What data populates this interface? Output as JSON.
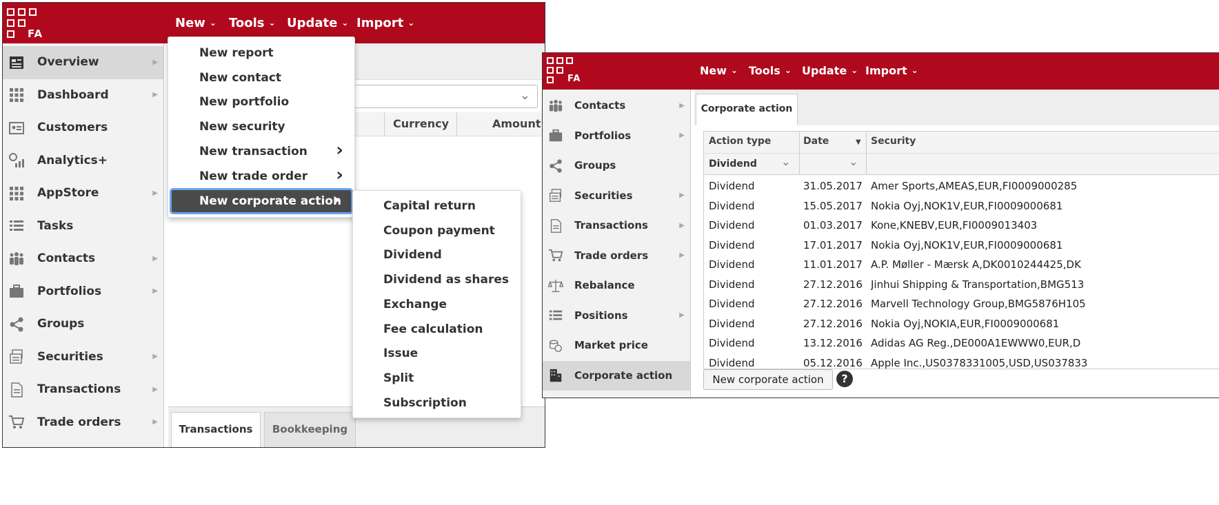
{
  "left": {
    "logo_text": "FA",
    "nav": [
      {
        "label": "New"
      },
      {
        "label": "Tools"
      },
      {
        "label": "Update"
      },
      {
        "label": "Import"
      }
    ],
    "sidebar": [
      {
        "label": "Overview",
        "icon": "overview-icon",
        "arrow": true,
        "active": true
      },
      {
        "label": "Dashboard",
        "icon": "dashboard-icon",
        "arrow": true
      },
      {
        "label": "Customers",
        "icon": "customers-icon",
        "arrow": false
      },
      {
        "label": "Analytics+",
        "icon": "analytics-icon",
        "arrow": false
      },
      {
        "label": "AppStore",
        "icon": "appstore-icon",
        "arrow": true
      },
      {
        "label": "Tasks",
        "icon": "tasks-icon",
        "arrow": false
      },
      {
        "label": "Contacts",
        "icon": "contacts-icon",
        "arrow": true
      },
      {
        "label": "Portfolios",
        "icon": "portfolios-icon",
        "arrow": true
      },
      {
        "label": "Groups",
        "icon": "groups-icon",
        "arrow": false
      },
      {
        "label": "Securities",
        "icon": "securities-icon",
        "arrow": true
      },
      {
        "label": "Transactions",
        "icon": "transactions-icon",
        "arrow": true
      },
      {
        "label": "Trade orders",
        "icon": "trade-orders-icon",
        "arrow": true
      }
    ],
    "table_headers": [
      "Currency",
      "Amount"
    ],
    "bottom_tabs": [
      "Transactions",
      "Bookkeeping"
    ],
    "new_menu": [
      {
        "label": "New report",
        "sub": false
      },
      {
        "label": "New contact",
        "sub": false
      },
      {
        "label": "New portfolio",
        "sub": false
      },
      {
        "label": "New security",
        "sub": false
      },
      {
        "label": "New transaction",
        "sub": true
      },
      {
        "label": "New trade order",
        "sub": true
      },
      {
        "label": "New corporate action",
        "sub": true,
        "highlighted": true
      }
    ],
    "submenu": [
      "Capital return",
      "Coupon payment",
      "Dividend",
      "Dividend as shares",
      "Exchange",
      "Fee calculation",
      "Issue",
      "Split",
      "Subscription"
    ]
  },
  "right": {
    "logo_text": "FA",
    "nav": [
      {
        "label": "New"
      },
      {
        "label": "Tools"
      },
      {
        "label": "Update"
      },
      {
        "label": "Import"
      }
    ],
    "sidebar": [
      {
        "label": "Contacts",
        "icon": "contacts-icon",
        "arrow": true
      },
      {
        "label": "Portfolios",
        "icon": "portfolios-icon",
        "arrow": true
      },
      {
        "label": "Groups",
        "icon": "groups-icon",
        "arrow": false
      },
      {
        "label": "Securities",
        "icon": "securities-icon",
        "arrow": true
      },
      {
        "label": "Transactions",
        "icon": "transactions-icon",
        "arrow": true
      },
      {
        "label": "Trade orders",
        "icon": "trade-orders-icon",
        "arrow": true
      },
      {
        "label": "Rebalance",
        "icon": "rebalance-icon",
        "arrow": false
      },
      {
        "label": "Positions",
        "icon": "positions-icon",
        "arrow": true
      },
      {
        "label": "Market price",
        "icon": "market-price-icon",
        "arrow": false
      },
      {
        "label": "Corporate action",
        "icon": "corporate-action-icon",
        "arrow": false,
        "active": true
      }
    ],
    "tab_label": "Corporate action",
    "columns": [
      "Action type",
      "Date",
      "Security"
    ],
    "filter_action_type": "Dividend",
    "rows": [
      {
        "type": "Dividend",
        "date": "31.05.2017",
        "security": "Amer Sports,AMEAS,EUR,FI0009000285"
      },
      {
        "type": "Dividend",
        "date": "15.05.2017",
        "security": "Nokia Oyj,NOK1V,EUR,FI0009000681"
      },
      {
        "type": "Dividend",
        "date": "01.03.2017",
        "security": "Kone,KNEBV,EUR,FI0009013403"
      },
      {
        "type": "Dividend",
        "date": "17.01.2017",
        "security": "Nokia Oyj,NOK1V,EUR,FI0009000681"
      },
      {
        "type": "Dividend",
        "date": "11.01.2017",
        "security": "A.P. Møller - Mærsk A,DK0010244425,DK"
      },
      {
        "type": "Dividend",
        "date": "27.12.2016",
        "security": "Jinhui Shipping & Transportation,BMG513"
      },
      {
        "type": "Dividend",
        "date": "27.12.2016",
        "security": "Marvell Technology Group,BMG5876H105"
      },
      {
        "type": "Dividend",
        "date": "27.12.2016",
        "security": "Nokia Oyj,NOKIA,EUR,FI0009000681"
      },
      {
        "type": "Dividend",
        "date": "13.12.2016",
        "security": "Adidas AG Reg.,DE000A1EWWW0,EUR,D"
      },
      {
        "type": "Dividend",
        "date": "05.12.2016",
        "security": "Apple Inc.,US0378331005,USD,US037833"
      }
    ],
    "new_button": "New corporate action",
    "help_symbol": "?"
  },
  "colors": {
    "brand": "#b0091d",
    "highlight": "#4a4a4a",
    "focus": "#6aa4ee"
  }
}
